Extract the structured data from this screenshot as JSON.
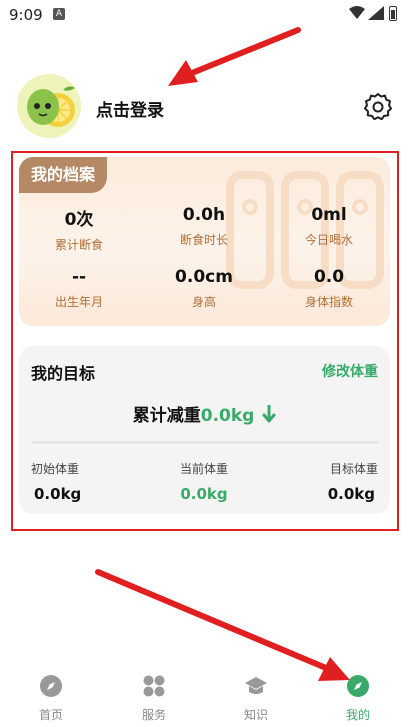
{
  "status_bar": {
    "time": "9:09",
    "notification_icon": "A"
  },
  "header": {
    "login_text": "点击登录",
    "settings_icon": "gear-icon"
  },
  "profile": {
    "tag": "我的档案",
    "stats": [
      {
        "value": "0次",
        "label": "累计断食"
      },
      {
        "value": "0.0h",
        "label": "断食时长"
      },
      {
        "value": "0ml",
        "label": "今日喝水"
      },
      {
        "value": "--",
        "label": "出生年月"
      },
      {
        "value": "0.0cm",
        "label": "身高"
      },
      {
        "value": "0.0",
        "label": "身体指数"
      }
    ]
  },
  "goal": {
    "title": "我的目标",
    "edit_label": "修改体重",
    "total_label": "累计减重",
    "total_value": "0.0kg",
    "weights": [
      {
        "label": "初始体重",
        "value": "0.0kg"
      },
      {
        "label": "当前体重",
        "value": "0.0kg"
      },
      {
        "label": "目标体重",
        "value": "0.0kg"
      }
    ]
  },
  "tabs": [
    {
      "label": "首页",
      "icon": "compass-icon"
    },
    {
      "label": "服务",
      "icon": "grid-icon"
    },
    {
      "label": "知识",
      "icon": "graduation-cap-icon"
    },
    {
      "label": "我的",
      "icon": "compass-icon",
      "active": true
    }
  ],
  "colors": {
    "accent": "#3aaa6a",
    "tag_bg": "#b58965",
    "label_brown": "#b0703a",
    "highlight_red": "#e02020"
  }
}
